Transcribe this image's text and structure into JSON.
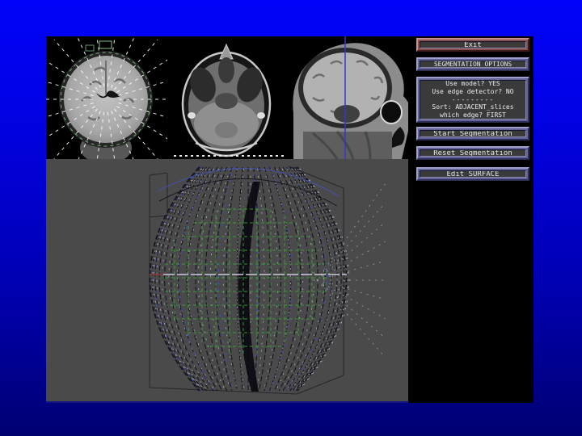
{
  "right_panel": {
    "exit_label": "Exit",
    "segmentation_options_label": "SEGMENTATION OPTIONS",
    "options_lines": [
      "Use model?  YES",
      "Use edge detector?  NO",
      "---------",
      "Sort: ADJACENT_slices",
      "which edge? FIRST"
    ],
    "start_label": "Start Segmentation",
    "reset_label": "Reset Segmentation",
    "edit_label": "Edit SURFACE"
  },
  "colors": {
    "slide_background_top": "#0202fa",
    "slide_background_bottom": "#000072",
    "panel_background": "#000000",
    "button_frame": "#62639a",
    "exit_button_frame": "#8a5050",
    "button_face": "#3a3a3a",
    "button_text": "#e8e8e8",
    "overlay_green": "#7fbf7f",
    "slice_line_blue": "#3636c8"
  },
  "render_view": {
    "background": "#4a4a4a",
    "grid_color": "#3f9b3f",
    "wire_dark": "#15151f",
    "wire_light": "#d2d6e2",
    "wire_blue": "#4452b8",
    "axis_line": "#c8ccd8",
    "axis_left_accent": "#7a3b3b",
    "box_color": "#26262c"
  }
}
